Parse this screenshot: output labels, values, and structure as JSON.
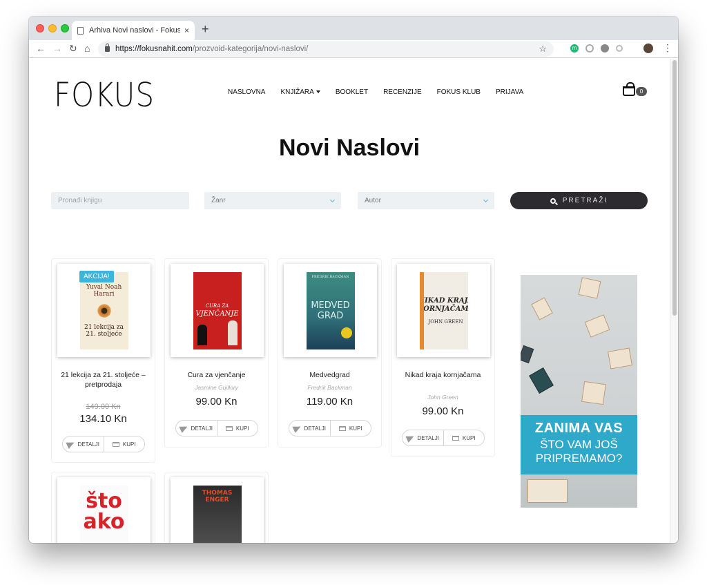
{
  "browser": {
    "tab_title": "Arhiva Novi naslovi - FokusNahit",
    "tab_close": "×",
    "new_tab": "+",
    "url_host": "https://fokusnahit.com",
    "url_path": "/prozvoid-kategorija/novi-naslovi/",
    "ext_label": "m"
  },
  "site": {
    "logo": "FOKUS",
    "nav": [
      "NASLOVNA",
      "KNJIŽARA",
      "BOOKLET",
      "RECENZIJE",
      "FOKUS KLUB",
      "PRIJAVA"
    ],
    "cart_count": "0"
  },
  "page_title": "Novi Naslovi",
  "filters": {
    "search_placeholder": "Pronađi knjigu",
    "genre_value": "Žanr",
    "author_value": "Autor",
    "search_button": "PRETRAŽI"
  },
  "products": [
    {
      "name": "21 lekcija za 21. stoljeće – pretprodaja",
      "old_price": "149.00 Kn",
      "price": "134.10 Kn",
      "badge": "AKCIJA!",
      "cover_author": "Yuval Noah Harari",
      "cover_title": "21 lekcija za 21. stoljeće"
    },
    {
      "name": "Cura za vjenčanje",
      "author": "Jasmine Guillory",
      "price": "99.00 Kn",
      "cover_title": "VJENČANJE",
      "cover_top": "CURA ZA"
    },
    {
      "name": "Medvedgrad",
      "author": "Fredrik Backman",
      "price": "119.00 Kn",
      "cover_top": "FREDRIK BACKMAN",
      "cover_title": "MEDVED GRAD"
    },
    {
      "name": "Nikad kraja kornjačama",
      "author": "John Green",
      "price": "99.00 Kn",
      "cover_title": "NIKAD KRAJA KORNJAČAMA",
      "cover_author": "JOHN GREEN"
    },
    {
      "cover_title": "što ako"
    },
    {
      "cover_author": "THOMAS ENGER"
    }
  ],
  "buttons": {
    "details": "DETALJI",
    "buy": "KUPI"
  },
  "ad": {
    "line1": "ZANIMA VAS",
    "line2": "ŠTO VAM JOŠ",
    "line3": "PRIPREMAMO?"
  }
}
